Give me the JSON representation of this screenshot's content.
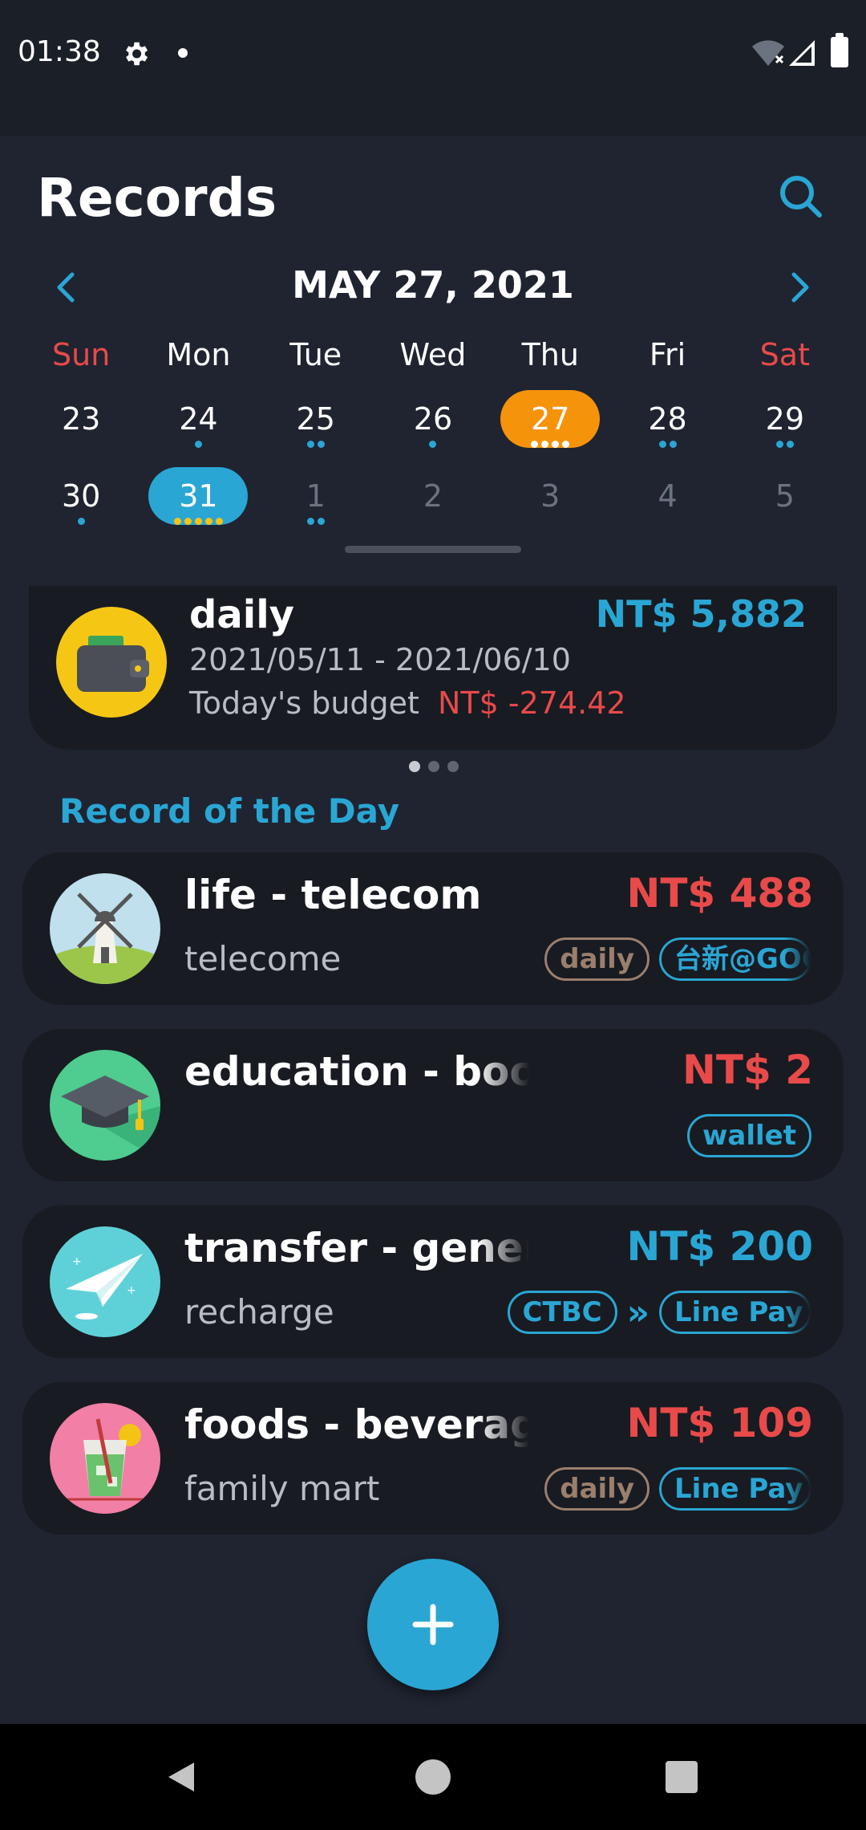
{
  "status_bar": {
    "time": "01:38"
  },
  "header": {
    "title": "Records"
  },
  "calendar": {
    "month_label": "MAY 27, 2021",
    "weekdays": [
      "Sun",
      "Mon",
      "Tue",
      "Wed",
      "Thu",
      "Fri",
      "Sat"
    ],
    "week1": [
      "23",
      "24",
      "25",
      "26",
      "27",
      "28",
      "29"
    ],
    "week2": [
      "30",
      "31",
      "1",
      "2",
      "3",
      "4",
      "5"
    ],
    "selected_day": "27",
    "today": "31"
  },
  "budget": {
    "name": "daily",
    "total": "NT$ 5,882",
    "range": "2021/05/11 - 2021/06/10",
    "today_label": "Today's budget",
    "today_value": "NT$ -274.42"
  },
  "section_title": "Record of the Day",
  "records": [
    {
      "title": "life - telecom",
      "note": "telecome",
      "amount": "NT$ 488",
      "tags": [
        "daily",
        "台新@GOGO"
      ]
    },
    {
      "title": "education - book",
      "note": "",
      "amount": "NT$ 2",
      "tags": [
        "wallet"
      ]
    },
    {
      "title": "transfer - general",
      "note": "recharge",
      "amount": "NT$ 200",
      "tags": [
        "CTBC",
        "Line Pay Money"
      ]
    },
    {
      "title": "foods - beverage",
      "note": "family mart",
      "amount": "NT$ 109",
      "tags": [
        "daily",
        "Line Pay Money"
      ]
    }
  ],
  "fab": {
    "label": "+"
  },
  "colors": {
    "accent": "#2aa6d4",
    "expense": "#e84a4a",
    "selected": "#f5930b",
    "today_dot": "#f3c316",
    "background": "#1f2430",
    "card": "#181b22"
  },
  "icons": [
    "settings-icon",
    "wifi-icon",
    "signal-icon",
    "battery-icon",
    "search-icon",
    "chevron-left-icon",
    "chevron-right-icon",
    "wallet-icon",
    "windmill-icon",
    "graduation-cap-icon",
    "paper-plane-icon",
    "drink-icon",
    "plus-icon",
    "back-icon",
    "home-icon",
    "recents-icon"
  ]
}
